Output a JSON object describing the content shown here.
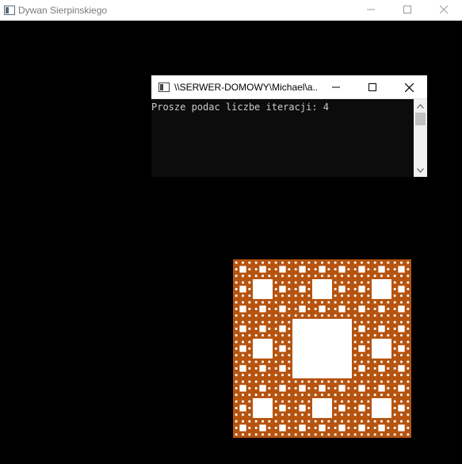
{
  "app": {
    "title": "Dywan Sierpinskiego",
    "controls": {
      "minimize": "minimize-icon",
      "maximize": "maximize-icon",
      "close": "close-icon"
    }
  },
  "console": {
    "title": "\\\\SERWER-DOMOWY\\Michael\\a...",
    "output": "Prosze podac liczbe iteracji: 4"
  },
  "carpet": {
    "iterations": 4,
    "color": "#b5530f",
    "hole_color": "#ffffff",
    "background": "#000000"
  }
}
